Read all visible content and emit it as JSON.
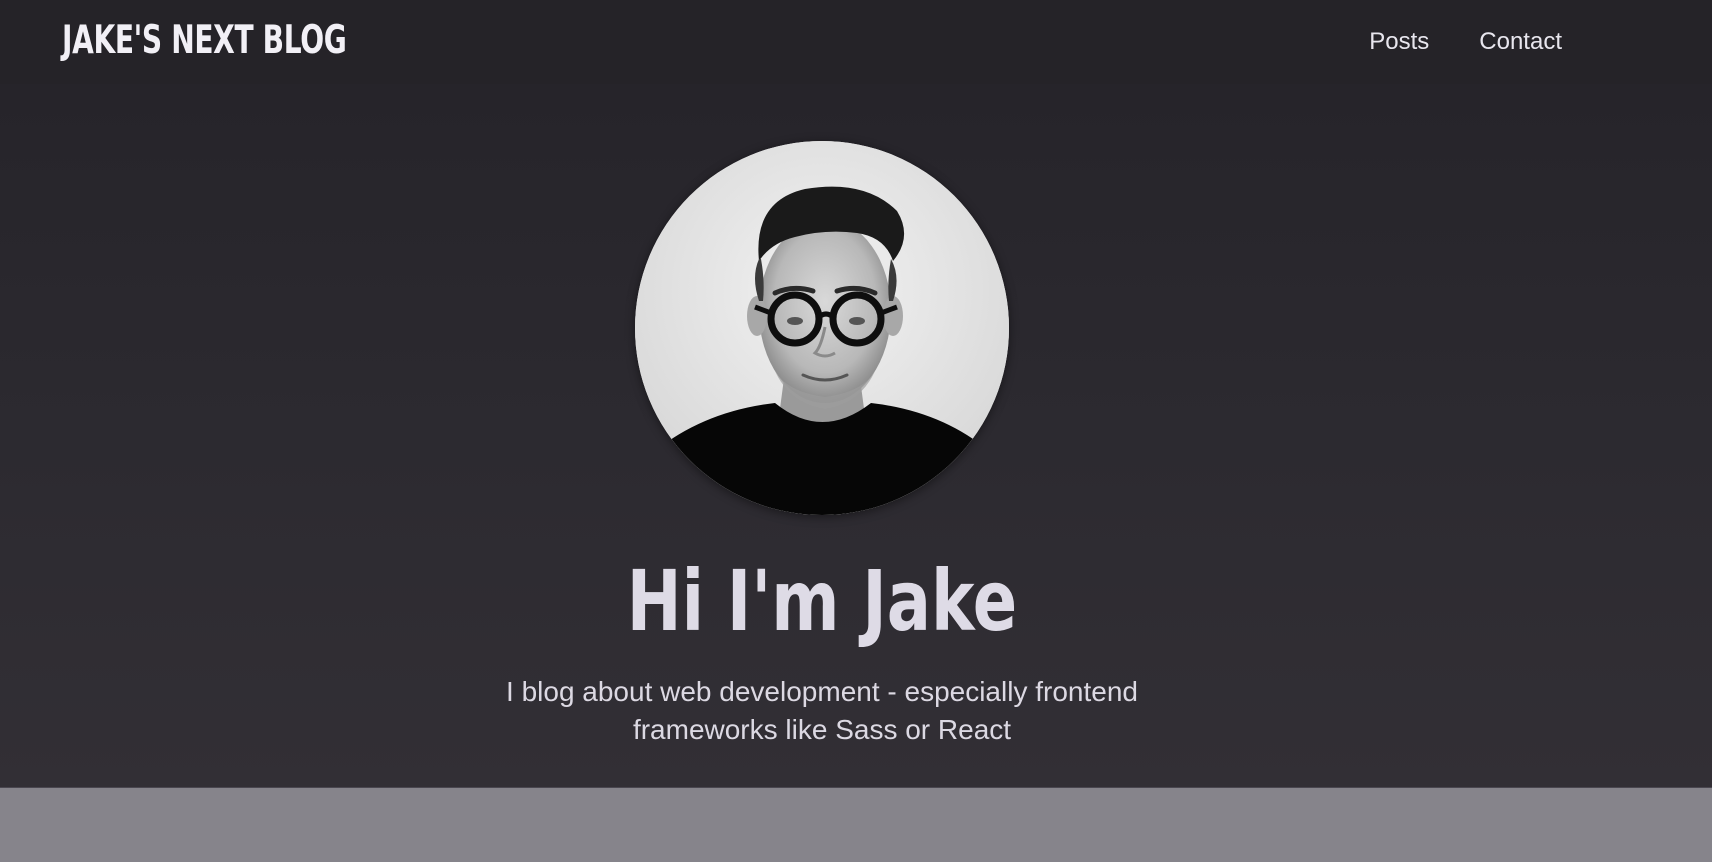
{
  "header": {
    "logo_text": "JAKE'S NEXT BLOG",
    "nav": [
      {
        "label": "Posts"
      },
      {
        "label": "Contact"
      }
    ]
  },
  "hero": {
    "avatar_alt": "Portrait of Jake",
    "title": "Hi I'm Jake",
    "description": "I blog about web development - especially frontend frameworks like Sass or React"
  },
  "colors": {
    "header_bg": "#252328",
    "hero_bg": "#2c2a30",
    "footer_bg": "#86848b",
    "text_light": "#dedbe6"
  }
}
